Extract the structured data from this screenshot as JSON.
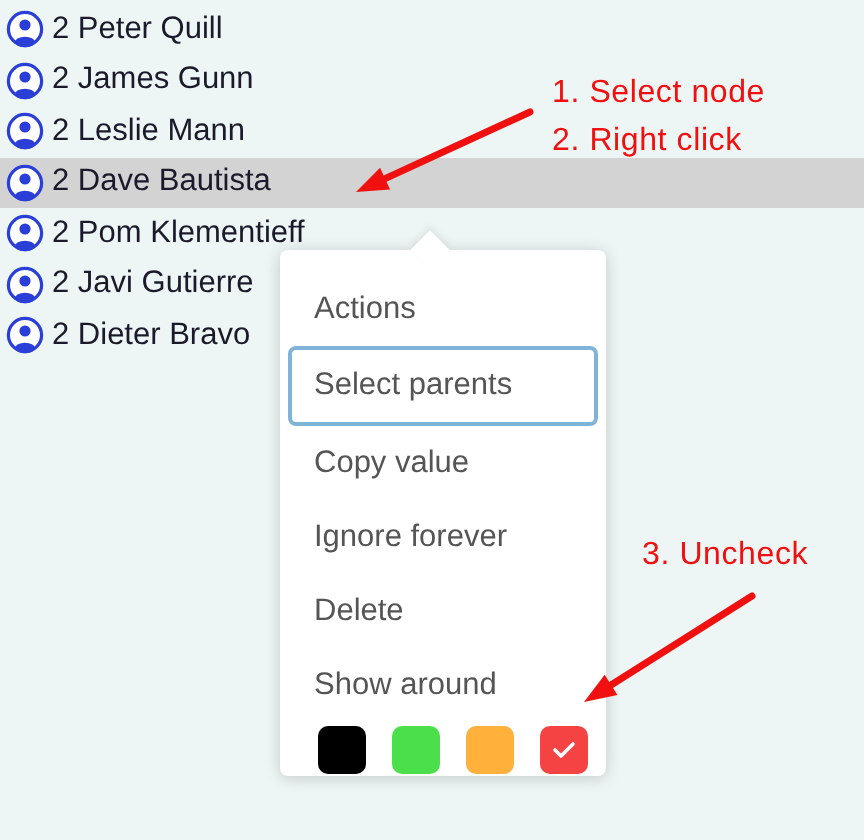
{
  "tree_rows": [
    {
      "label": "2 Peter Quill",
      "selected": false
    },
    {
      "label": "2 James Gunn",
      "selected": false
    },
    {
      "label": "2 Leslie Mann",
      "selected": false
    },
    {
      "label": "2 Dave Bautista",
      "selected": true
    },
    {
      "label": "2 Pom Klementieff",
      "selected": false
    },
    {
      "label": "2 Javi Gutierre",
      "selected": false
    },
    {
      "label": "2 Dieter Bravo",
      "selected": false
    }
  ],
  "context_menu": {
    "title": "Actions",
    "items": [
      {
        "label": "Select parents",
        "focused": true
      },
      {
        "label": "Copy value",
        "focused": false
      },
      {
        "label": "Ignore forever",
        "focused": false
      },
      {
        "label": "Delete",
        "focused": false
      }
    ],
    "swatch_label": "Show around",
    "swatches": [
      {
        "color": "#000000",
        "checked": false
      },
      {
        "color": "#4be04b",
        "checked": false
      },
      {
        "color": "#ffb13b",
        "checked": false
      },
      {
        "color": "#f54242",
        "checked": true
      }
    ]
  },
  "annotations": [
    "1. Select node",
    "2. Right click",
    "3. Uncheck"
  ]
}
